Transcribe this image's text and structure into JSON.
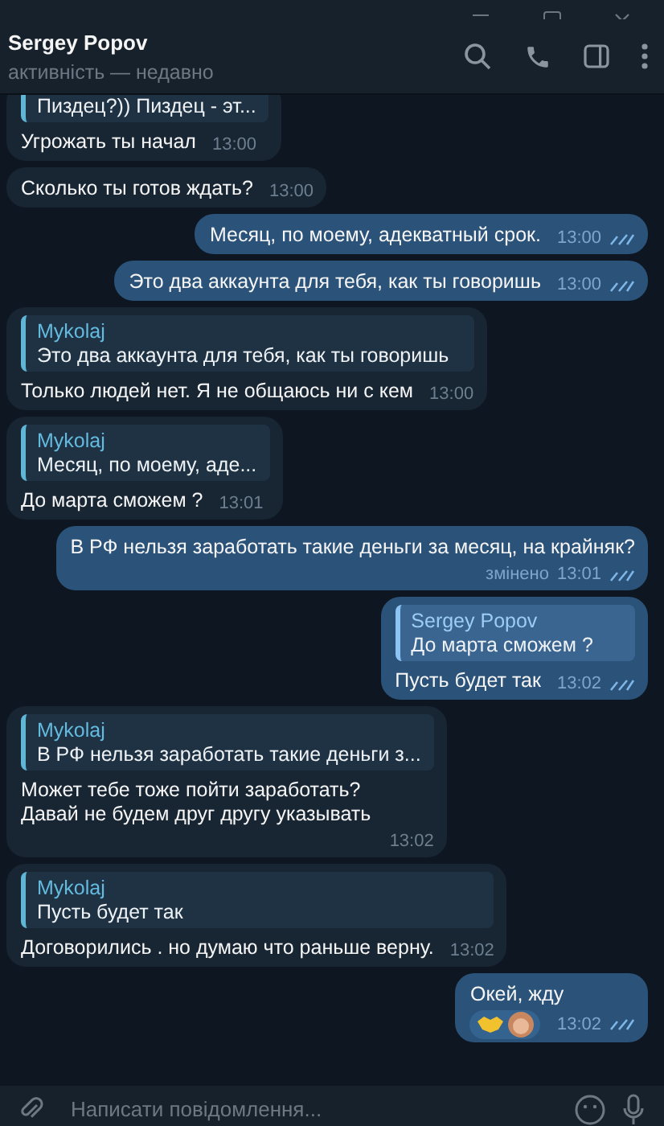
{
  "header": {
    "name": "Sergey Popov",
    "status": "активність — недавно"
  },
  "messages": [
    {
      "outgoing": false,
      "reply": {
        "text": "Пиздец?)) Пиздец - эт..."
      },
      "lines": [
        "Угрожать ты начал"
      ],
      "time": "13:00"
    },
    {
      "outgoing": false,
      "lines": [
        "Сколько ты готов ждать?"
      ],
      "time": "13:00"
    },
    {
      "outgoing": true,
      "lines": [
        "Месяц, по моему, адекватный срок."
      ],
      "time": "13:00",
      "read": true
    },
    {
      "outgoing": true,
      "lines": [
        "Это два аккаунта для тебя, как ты говоришь"
      ],
      "time": "13:00",
      "read": true
    },
    {
      "outgoing": false,
      "reply": {
        "author": "Mykolaj",
        "text": "Это два аккаунта для тебя, как ты говоришь"
      },
      "lines": [
        "Только людей нет. Я не общаюсь ни с кем"
      ],
      "time": "13:00"
    },
    {
      "outgoing": false,
      "reply": {
        "author": "Mykolaj",
        "text": "Месяц, по моему, аде..."
      },
      "lines": [
        "До марта сможем ?"
      ],
      "time": "13:01"
    },
    {
      "outgoing": true,
      "lines": [
        "В РФ нельзя заработать такие деньги за месяц, на крайняк?"
      ],
      "edited": "змінено",
      "time": "13:01",
      "read": true
    },
    {
      "outgoing": true,
      "reply": {
        "author": "Sergey Popov",
        "text": "До марта сможем ?"
      },
      "lines": [
        "Пусть будет так"
      ],
      "time": "13:02",
      "read": true
    },
    {
      "outgoing": false,
      "reply": {
        "author": "Mykolaj",
        "text": "В РФ нельзя заработать такие деньги з..."
      },
      "lines": [
        "Может тебе тоже пойти заработать?",
        "Давай не будем друг другу указывать"
      ],
      "time": "13:02"
    },
    {
      "outgoing": false,
      "reply": {
        "author": "Mykolaj",
        "text": "Пусть будет так"
      },
      "lines": [
        "Договорились . но думаю что раньше верну."
      ],
      "time": "13:02"
    },
    {
      "outgoing": true,
      "lines": [
        "Окей, жду"
      ],
      "reaction": true,
      "time": "13:02",
      "read": true
    }
  ],
  "composer": {
    "placeholder": "Написати повідомлення..."
  }
}
